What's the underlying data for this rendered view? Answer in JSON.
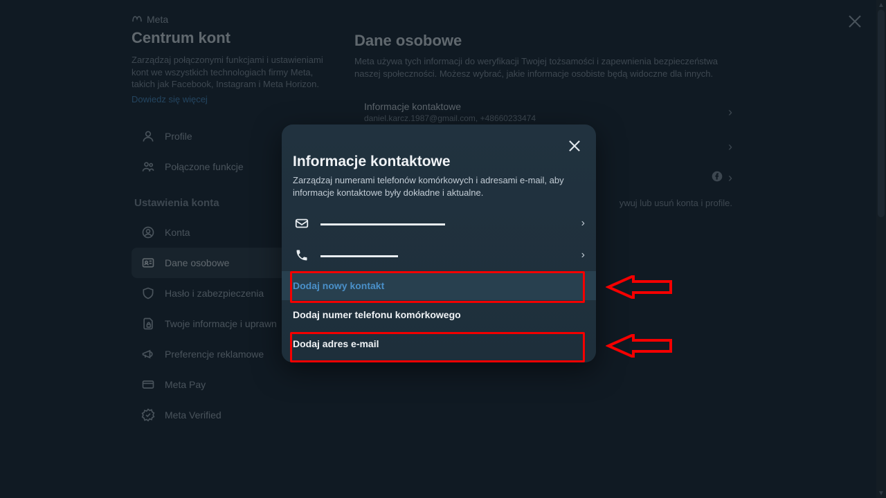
{
  "brand": "Meta",
  "sidebar": {
    "title": "Centrum kont",
    "desc": "Zarządzaj połączonymi funkcjami i ustawieniami kont we wszystkich technologiach firmy Meta, takich jak Facebook, Instagram i Meta Horizon.",
    "learn_more": "Dowiedz się więcej",
    "items": {
      "profile": "Profile",
      "connected": "Połączone funkcje"
    },
    "section_label": "Ustawienia konta",
    "settings": {
      "accounts": "Konta",
      "personal": "Dane osobowe",
      "password": "Hasło i zabezpieczenia",
      "info": "Twoje informacje i uprawn",
      "ads": "Preferencje reklamowe",
      "pay": "Meta Pay",
      "verified": "Meta Verified"
    }
  },
  "main": {
    "title": "Dane osobowe",
    "desc": "Meta używa tych informacji do weryfikacji Twojej tożsamości i zapewnienia bezpieczeństwa naszej społeczności. Możesz wybrać, jakie informacje osobiste będą widoczne dla innych.",
    "contact": {
      "label": "Informacje kontaktowe",
      "value": "daniel.karcz.1987@gmail.com, +48660233474"
    },
    "manage_note": "ywuj lub usuń konta i profile."
  },
  "modal": {
    "title": "Informacje kontaktowe",
    "desc": "Zarządzaj numerami telefonów komórkowych i adresami e-mail, aby informacje kontaktowe były dokładne i aktualne.",
    "add_contact": "Dodaj nowy kontakt",
    "add_phone": "Dodaj numer telefonu komórkowego",
    "add_email": "Dodaj adres e-mail"
  }
}
